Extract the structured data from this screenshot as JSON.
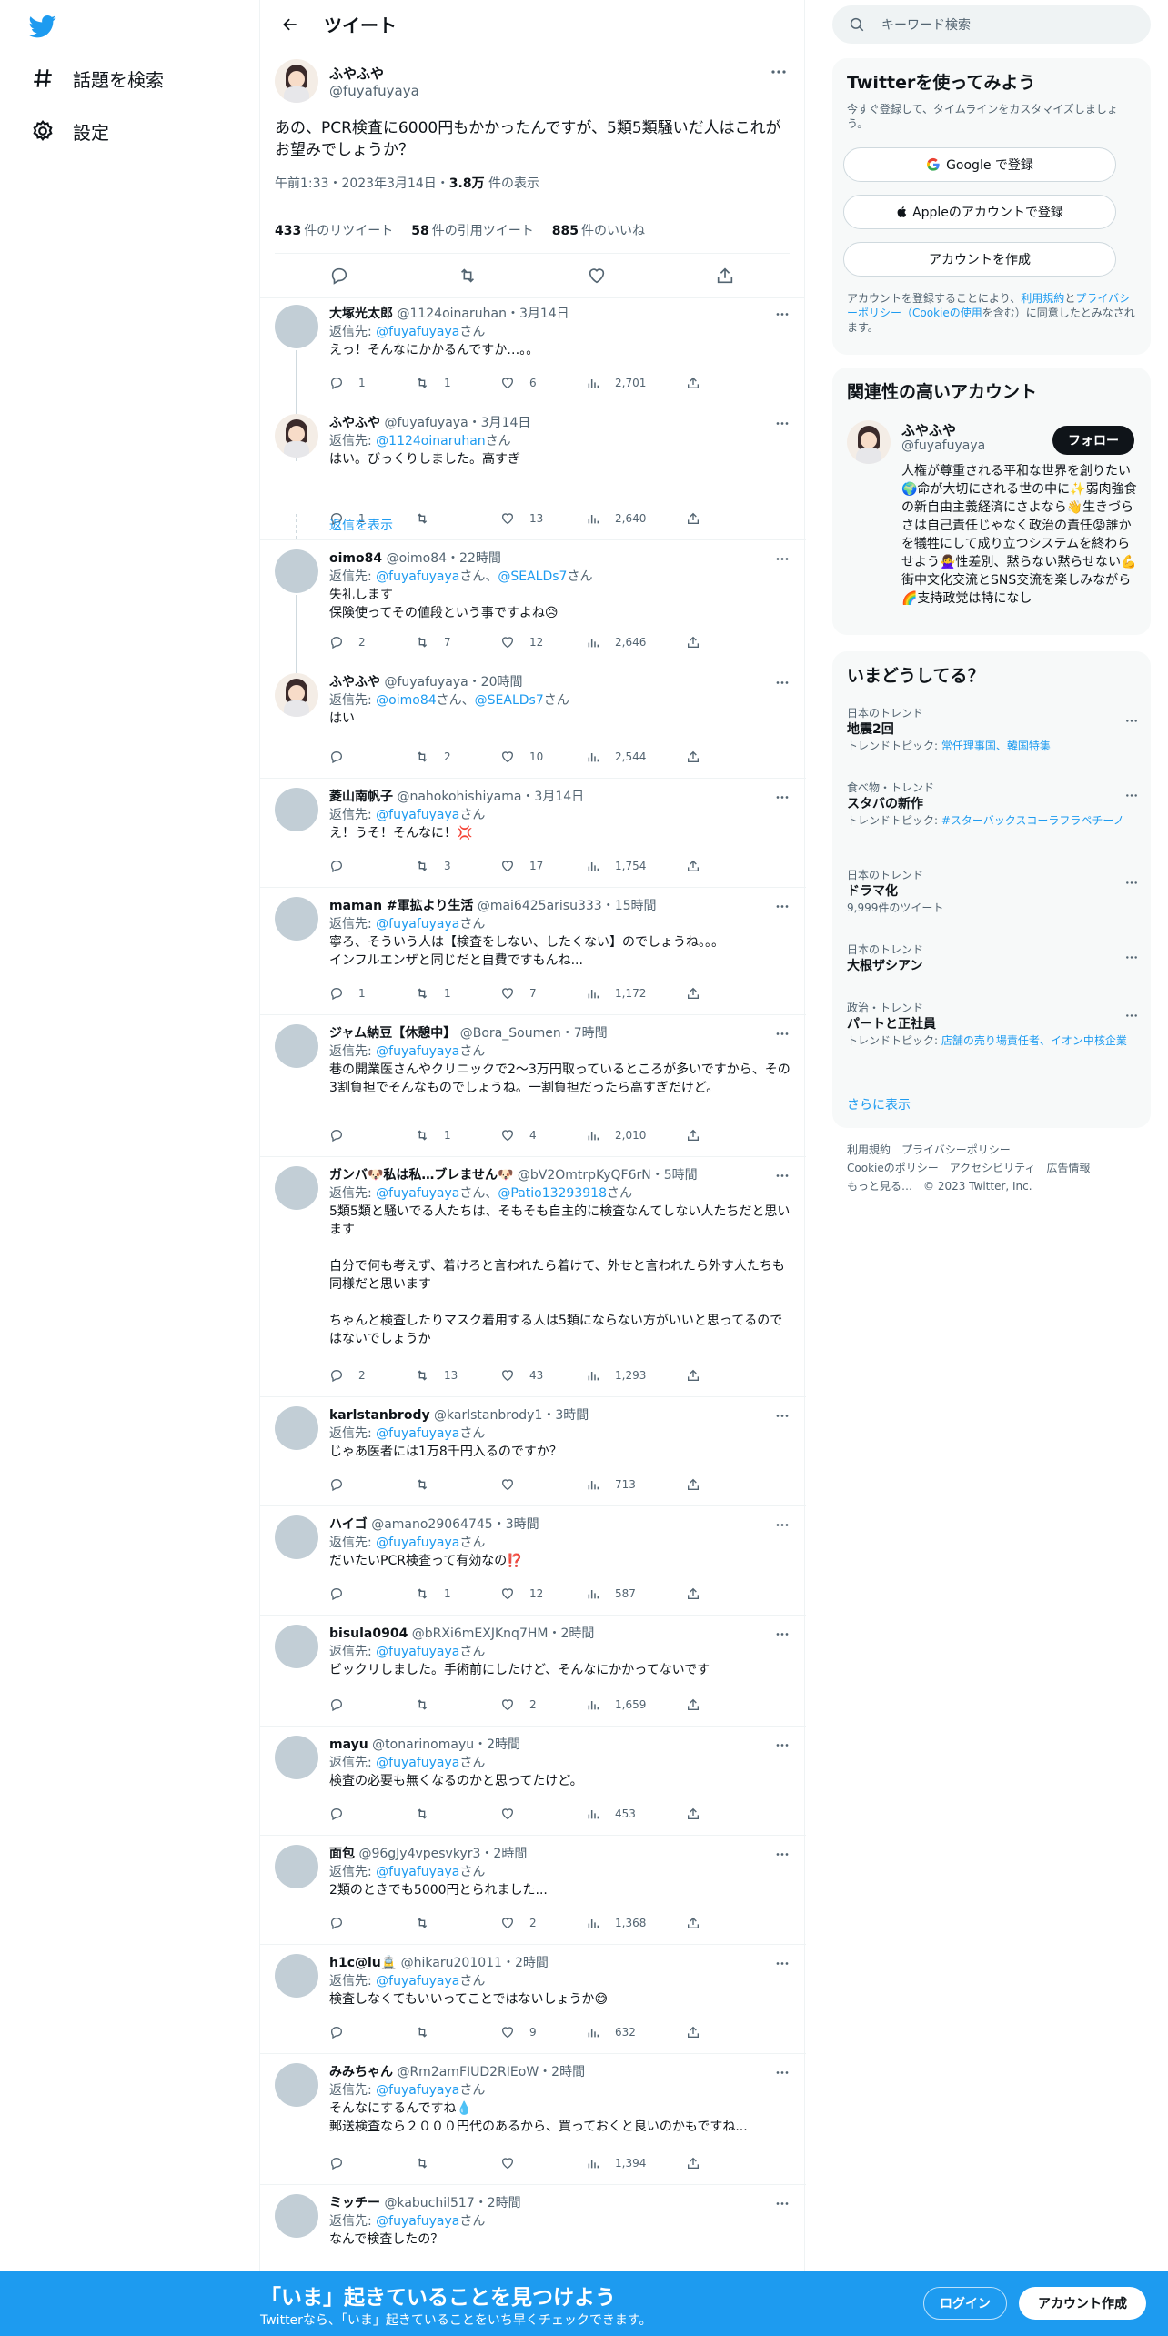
{
  "nav": {
    "explore_label": "話題を検索",
    "settings_label": "設定"
  },
  "header": {
    "title": "ツイート"
  },
  "main_tweet": {
    "name": "ふやふや",
    "handle": "@fuyafuyaya",
    "text": "あの、PCR検査に6000円もかかったんですが、5類5類騒いだ人はこれがお望みでしょうか？",
    "time": "午前1:33・2023年3月14日・",
    "views": "3.8万",
    "views_suffix": " 件の表示",
    "retweets": "433",
    "retweets_label": "件のリツイート",
    "quotes": "58",
    "quotes_label": "件の引用ツイート",
    "likes": "885",
    "likes_label": "件のいいね"
  },
  "replies": [
    {
      "name": "大塚光太郎",
      "handle": "@1124oinaruhan",
      "time": "3月14日",
      "to": [
        "@fuyafuyaya"
      ],
      "to_suffix": "さん",
      "text": "えっ！そんなにかかるんですか…。。",
      "reply": "1",
      "rt": "1",
      "like": "6",
      "views": "2,701",
      "me": false
    },
    {
      "name": "ふやふや",
      "handle": "@fuyafuyaya",
      "time": "3月14日",
      "to": [
        "@1124oinaruhan"
      ],
      "to_suffix": "さん",
      "text": "はい。びっくりしました。高すぎ",
      "reply": "1",
      "rt": "",
      "like": "13",
      "views": "2,640",
      "me": true
    },
    {
      "name": "oimo84",
      "handle": "@oimo84",
      "time": "22時間",
      "to": [
        "@fuyafuyaya",
        "@SEALDs7"
      ],
      "to_suffix": "さん",
      "text": "失礼します\n保険使ってその値段という事ですよね😥",
      "reply": "2",
      "rt": "7",
      "like": "12",
      "views": "2,646",
      "me": false
    },
    {
      "name": "ふやふや",
      "handle": "@fuyafuyaya",
      "time": "20時間",
      "to": [
        "@oimo84",
        "@SEALDs7"
      ],
      "to_suffix": "さん",
      "text": "はい",
      "reply": "",
      "rt": "2",
      "like": "10",
      "views": "2,544",
      "me": true
    },
    {
      "name": "菱山南帆子",
      "handle": "@nahokohishiyama",
      "time": "3月14日",
      "to": [
        "@fuyafuyaya"
      ],
      "to_suffix": "さん",
      "text": "え！うそ！そんなに！💢",
      "reply": "",
      "rt": "3",
      "like": "17",
      "views": "1,754",
      "me": false
    },
    {
      "name": "maman #軍拡より生活",
      "handle": "@mai6425arisu333",
      "time": "15時間",
      "to": [
        "@fuyafuyaya"
      ],
      "to_suffix": "さん",
      "text": "寧ろ、そういう人は【検査をしない、したくない】のでしょうね。。。\nインフルエンザと同じだと自費ですもんね...",
      "reply": "1",
      "rt": "1",
      "like": "7",
      "views": "1,172",
      "me": false
    },
    {
      "name": "ジャム納豆【休憩中】",
      "handle": "@Bora_Soumen",
      "time": "7時間",
      "to": [
        "@fuyafuyaya"
      ],
      "to_suffix": "さん",
      "text": "巷の開業医さんやクリニックで2～3万円取っているところが多いですから、その3割負担でそんなものでしょうね。一割負担だったら高すぎだけど。",
      "reply": "",
      "rt": "1",
      "like": "4",
      "views": "2,010",
      "me": false
    },
    {
      "name": "ガンバ🐶私は私…ブレません🐶",
      "handle": "@bV2OmtrpKyQF6rN",
      "time": "5時間",
      "to": [
        "@fuyafuyaya",
        "@Patio13293918"
      ],
      "to_suffix": "さん",
      "text": "5類5類と騒いでる人たちは、そもそも自主的に検査なんてしない人たちだと思います\n\n自分で何も考えず、着けろと言われたら着けて、外せと言われたら外す人たちも同様だと思います\n\nちゃんと検査したりマスク着用する人は5類にならない方がいいと思ってるのではないでしょうか",
      "reply": "2",
      "rt": "13",
      "like": "43",
      "views": "1,293",
      "me": false
    },
    {
      "name": "karlstanbrody",
      "handle": "@karlstanbrody1",
      "time": "3時間",
      "to": [
        "@fuyafuyaya"
      ],
      "to_suffix": "さん",
      "text": "じゃあ医者には1万8千円入るのですか？",
      "reply": "",
      "rt": "",
      "like": "",
      "views": "713",
      "me": false
    },
    {
      "name": "ハイゴ",
      "handle": "@amano29064745",
      "time": "3時間",
      "to": [
        "@fuyafuyaya"
      ],
      "to_suffix": "さん",
      "text": "だいたいPCR検査って有効なの⁉️",
      "reply": "",
      "rt": "1",
      "like": "12",
      "views": "587",
      "me": false
    },
    {
      "name": "bisula0904",
      "handle": "@bRXi6mEXJKnq7HM",
      "time": "2時間",
      "to": [
        "@fuyafuyaya"
      ],
      "to_suffix": "さん",
      "text": "ビックリしました。手術前にしたけど、そんなにかかってないです",
      "reply": "",
      "rt": "",
      "like": "2",
      "views": "1,659",
      "me": false
    },
    {
      "name": "mayu",
      "handle": "@tonarinomayu",
      "time": "2時間",
      "to": [
        "@fuyafuyaya"
      ],
      "to_suffix": "さん",
      "text": "検査の必要も無くなるのかと思ってたけど。",
      "reply": "",
      "rt": "",
      "like": "",
      "views": "453",
      "me": false
    },
    {
      "name": "面包",
      "handle": "@96gJy4vpesvkyr3",
      "time": "2時間",
      "to": [
        "@fuyafuyaya"
      ],
      "to_suffix": "さん",
      "text": "2類のときでも5000円とられました...",
      "reply": "",
      "rt": "",
      "like": "2",
      "views": "1,368",
      "me": false
    },
    {
      "name": "h1c@lu🚊",
      "handle": "@hikaru201011",
      "time": "2時間",
      "to": [
        "@fuyafuyaya"
      ],
      "to_suffix": "さん",
      "text": "検査しなくてもいいってことではないしょうか😅",
      "reply": "",
      "rt": "",
      "like": "9",
      "views": "632",
      "me": false
    },
    {
      "name": "みみちゃん",
      "handle": "@Rm2amFIUD2RIEoW",
      "time": "2時間",
      "to": [
        "@fuyafuyaya"
      ],
      "to_suffix": "さん",
      "text": "そんなにするんですね💧\n郵送検査なら２０００円代のあるから、買っておくと良いのかもですね...",
      "reply": "",
      "rt": "",
      "like": "",
      "views": "1,394",
      "me": false
    },
    {
      "name": "ミッチー",
      "handle": "@kabuchil517",
      "time": "2時間",
      "to": [
        "@fuyafuyaya"
      ],
      "to_suffix": "さん",
      "text": "なんで検査したの？",
      "reply": "",
      "rt": "",
      "like": "",
      "views": "",
      "me": false
    }
  ],
  "reply_to_prefix": "返信先: ",
  "show_thread_label": "返信を表示",
  "right": {
    "search_placeholder": "キーワード検索",
    "signup_card": {
      "title": "Twitterを使ってみよう",
      "subtitle": "今すぐ登録して、タイムラインをカスタマイズしましょう。",
      "google_label": "Google で登録",
      "apple_label": "Appleのアカウントで登録",
      "create_label": "アカウントを作成",
      "legal_prefix": "アカウントを登録することにより、",
      "legal_link1": "利用規約",
      "legal_and": "と",
      "legal_link2": "プライバシーポリシー",
      "legal_link3": "（Cookieの使用",
      "legal_suffix": "を含む）に同意したとみなされます。"
    },
    "related": {
      "title": "関連性の高いアカウント",
      "name": "ふやふや",
      "handle": "@fuyafuyaya",
      "follow_label": "フォロー",
      "bio": "人権が尊重される平和な世界を創りたい🌍命が大切にされる世の中に✨弱肉強食の新自由主義経済にさよなら👋生きづらさは自己責任じゃなく政治の責任😡誰かを犠牲にして成り立つシステムを終わらせよう🙅‍♀️性差別、黙らない黙らせない💪街中文化交流とSNS交流を楽しみながら🌈支持政党は特になし"
    },
    "trends": {
      "title": "いまどうしてる？",
      "items": [
        {
          "category": "日本のトレンド",
          "title": "地震2回",
          "sub_prefix": "トレンドトピック: ",
          "sub_link": "常任理事国、韓国特集"
        },
        {
          "category": "食べ物・トレンド",
          "title": "スタバの新作",
          "sub_prefix": "トレンドトピック: ",
          "sub_link": "#スターバックスコーラフラペチーノ"
        },
        {
          "category": "日本のトレンド",
          "title": "ドラマ化",
          "sub_prefix": "9,999件のツイート",
          "sub_link": ""
        },
        {
          "category": "日本のトレンド",
          "title": "大根ザシアン",
          "sub_prefix": "",
          "sub_link": ""
        },
        {
          "category": "政治・トレンド",
          "title": "パートと正社員",
          "sub_prefix": "トレンドトピック: ",
          "sub_link": "店舗の売り場責任者、イオン中核企業"
        }
      ],
      "show_more": "さらに表示"
    },
    "footer": {
      "line1": "利用規約　プライバシーポリシー",
      "line2": "Cookieのポリシー　アクセシビリティ　広告情報",
      "line3": "もっと見る…　© 2023 Twitter, Inc."
    }
  },
  "bottom_bar": {
    "title": "「いま」起きていることを見つけよう",
    "subtitle": "Twitterなら、「いま」起きていることをいち早くチェックできます。",
    "login_label": "ログイン",
    "signup_label": "アカウント作成"
  },
  "colors": {
    "brand": "#1d9bf0",
    "text": "#0f1419",
    "muted": "#536471"
  }
}
